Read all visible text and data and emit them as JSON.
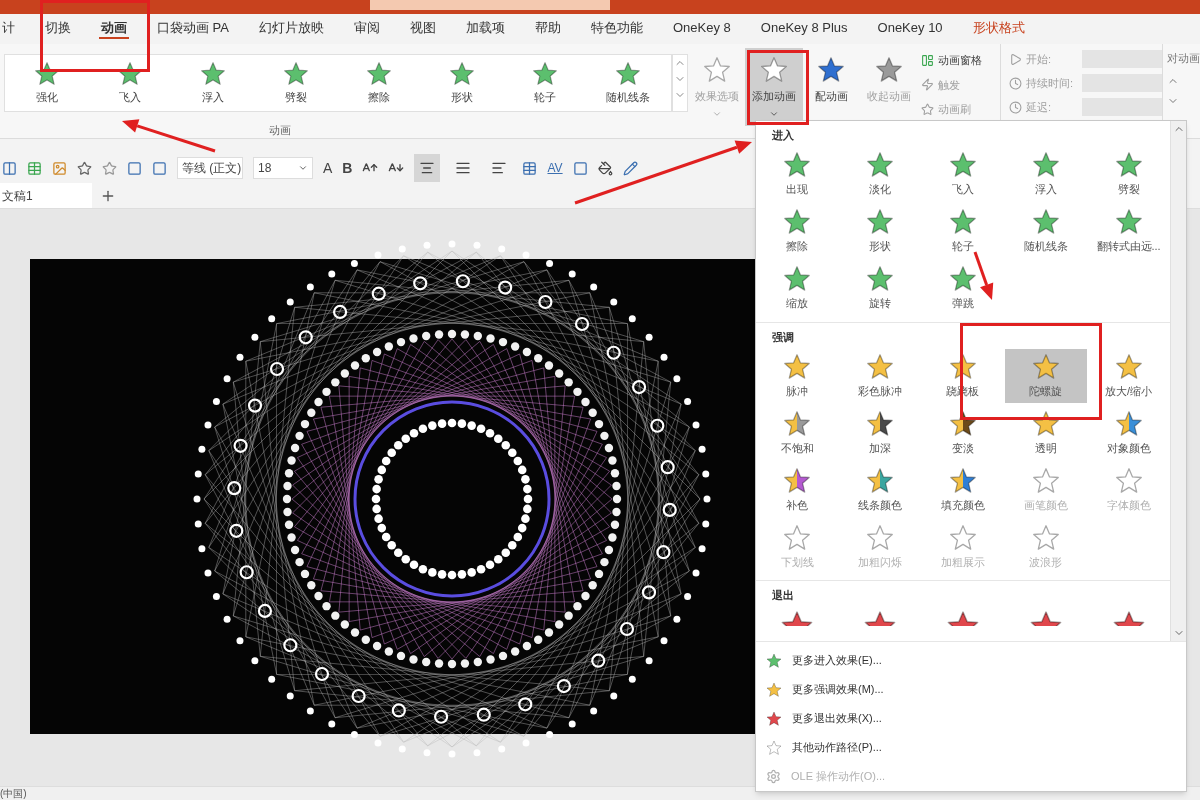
{
  "ribbon_tabs": [
    {
      "label": "计",
      "selected": false,
      "kind": "normal"
    },
    {
      "label": "切换",
      "selected": false,
      "kind": "normal"
    },
    {
      "label": "动画",
      "selected": true,
      "kind": "normal"
    },
    {
      "label": "口袋动画 PA",
      "selected": false,
      "kind": "normal"
    },
    {
      "label": "幻灯片放映",
      "selected": false,
      "kind": "normal"
    },
    {
      "label": "审阅",
      "selected": false,
      "kind": "normal"
    },
    {
      "label": "视图",
      "selected": false,
      "kind": "normal"
    },
    {
      "label": "加载项",
      "selected": false,
      "kind": "normal"
    },
    {
      "label": "帮助",
      "selected": false,
      "kind": "normal"
    },
    {
      "label": "特色功能",
      "selected": false,
      "kind": "normal"
    },
    {
      "label": "OneKey 8",
      "selected": false,
      "kind": "normal"
    },
    {
      "label": "OneKey 8 Plus",
      "selected": false,
      "kind": "normal"
    },
    {
      "label": "OneKey 10",
      "selected": false,
      "kind": "normal"
    },
    {
      "label": "形状格式",
      "selected": false,
      "kind": "contextual"
    }
  ],
  "animation_gallery": {
    "group_label": "动画",
    "items": [
      {
        "label": "强化"
      },
      {
        "label": "飞入"
      },
      {
        "label": "浮入"
      },
      {
        "label": "劈裂"
      },
      {
        "label": "擦除"
      },
      {
        "label": "形状"
      },
      {
        "label": "轮子"
      },
      {
        "label": "随机线条"
      }
    ]
  },
  "large_buttons": [
    {
      "label": "效果选项",
      "kind": "options",
      "disabled": true,
      "selected": false
    },
    {
      "label": "添加动画",
      "kind": "add",
      "disabled": false,
      "selected": true
    },
    {
      "label": "配动画",
      "kind": "pair",
      "disabled": false,
      "selected": false
    },
    {
      "label": "收起动画",
      "kind": "collapse",
      "disabled": true,
      "selected": false
    }
  ],
  "small_buttons": [
    {
      "label": "动画窗格",
      "kind": "pane",
      "disabled": false
    },
    {
      "label": "触发",
      "kind": "trigger",
      "disabled": true
    },
    {
      "label": "动画刷",
      "kind": "painter",
      "disabled": true
    }
  ],
  "timing": [
    {
      "label": "开始:",
      "kind": "start"
    },
    {
      "label": "持续时间:",
      "kind": "duration"
    },
    {
      "label": "延迟:",
      "kind": "delay"
    }
  ],
  "reorder_label": "对动画",
  "format_toolbar": {
    "font": "等线 (正文)",
    "size": "18",
    "text_buttons": [
      {
        "label": "A",
        "kind": "color"
      },
      {
        "label": "B",
        "kind": "bold"
      }
    ],
    "align_buttons": [
      {
        "selected": true
      },
      {
        "selected": false
      },
      {
        "selected": false
      }
    ],
    "spacing": "AV"
  },
  "document_tab": {
    "title": "文稿1"
  },
  "effects_menu": {
    "sections": [
      {
        "title": "进入",
        "color": "#5cbf6e",
        "items": [
          {
            "label": "出现",
            "disabled": false
          },
          {
            "label": "淡化",
            "disabled": false
          },
          {
            "label": "飞入",
            "disabled": false
          },
          {
            "label": "浮入",
            "disabled": false
          },
          {
            "label": "劈裂",
            "disabled": false
          },
          {
            "label": "擦除",
            "disabled": false
          },
          {
            "label": "形状",
            "disabled": false
          },
          {
            "label": "轮子",
            "disabled": false
          },
          {
            "label": "随机线条",
            "disabled": false
          },
          {
            "label": "翻转式由远...",
            "disabled": false
          },
          {
            "label": "缩放",
            "disabled": false
          },
          {
            "label": "旋转",
            "disabled": false
          },
          {
            "label": "弹跳",
            "disabled": false
          }
        ]
      },
      {
        "title": "强调",
        "color": "#f4c044",
        "items": [
          {
            "label": "脉冲",
            "disabled": false
          },
          {
            "label": "彩色脉冲",
            "disabled": false
          },
          {
            "label": "跷跷板",
            "disabled": false
          },
          {
            "label": "陀螺旋",
            "disabled": false,
            "selected": true
          },
          {
            "label": "放大/缩小",
            "disabled": false
          },
          {
            "label": "不饱和",
            "disabled": false,
            "color": "#9a9a9a"
          },
          {
            "label": "加深",
            "disabled": false,
            "color": "#4a4a4a"
          },
          {
            "label": "变淡",
            "disabled": false,
            "color": "#6b4a1a"
          },
          {
            "label": "透明",
            "disabled": false
          },
          {
            "label": "对象颜色",
            "disabled": false,
            "color": "#3a8fd8"
          },
          {
            "label": "补色",
            "disabled": false,
            "color": "#b45ad0"
          },
          {
            "label": "线条颜色",
            "disabled": false,
            "color": "#3aa6a0"
          },
          {
            "label": "填充颜色",
            "disabled": false,
            "color": "#2f7fd6"
          },
          {
            "label": "画笔颜色",
            "disabled": true
          },
          {
            "label": "字体颜色",
            "disabled": true
          },
          {
            "label": "下划线",
            "disabled": true
          },
          {
            "label": "加粗闪烁",
            "disabled": true
          },
          {
            "label": "加粗展示",
            "disabled": true
          },
          {
            "label": "波浪形",
            "disabled": true
          }
        ]
      },
      {
        "title": "退出",
        "color": "#e0474c",
        "items": [
          {
            "kind": "cut"
          },
          {
            "kind": "cut"
          },
          {
            "kind": "cut"
          },
          {
            "kind": "cut"
          },
          {
            "kind": "cut"
          }
        ]
      }
    ],
    "commands": [
      {
        "label": "更多进入效果(E)...",
        "kind": "enter",
        "disabled": false
      },
      {
        "label": "更多强调效果(M)...",
        "kind": "emphasis",
        "disabled": false
      },
      {
        "label": "更多退出效果(X)...",
        "kind": "exit",
        "disabled": false
      },
      {
        "label": "其他动作路径(P)...",
        "kind": "path",
        "disabled": false
      },
      {
        "label": "OLE 操作动作(O)...",
        "kind": "ole",
        "disabled": true
      }
    ]
  },
  "status_bar": {
    "language": "(中国)"
  }
}
